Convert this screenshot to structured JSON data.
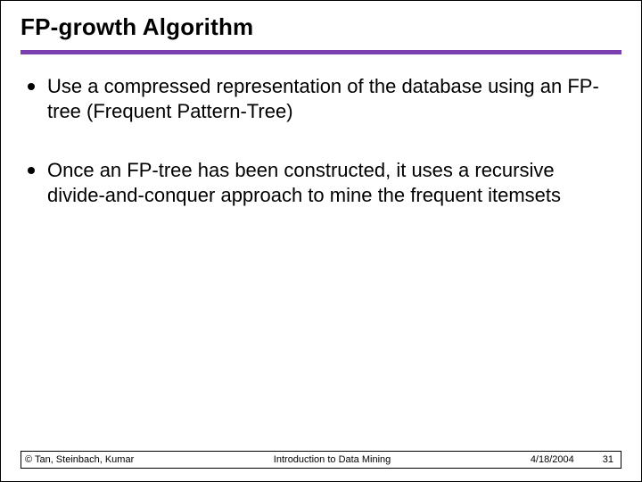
{
  "title": "FP-growth Algorithm",
  "bullets": [
    "Use a compressed representation of the database using an FP-tree (Frequent Pattern-Tree)",
    "Once an FP-tree has been constructed, it uses a recursive divide-and-conquer approach to mine the frequent itemsets"
  ],
  "footer": {
    "authors": "© Tan, Steinbach, Kumar",
    "course": "Introduction to Data Mining",
    "date": "4/18/2004",
    "page": "31"
  },
  "colors": {
    "rule": "#7b3fb0"
  }
}
